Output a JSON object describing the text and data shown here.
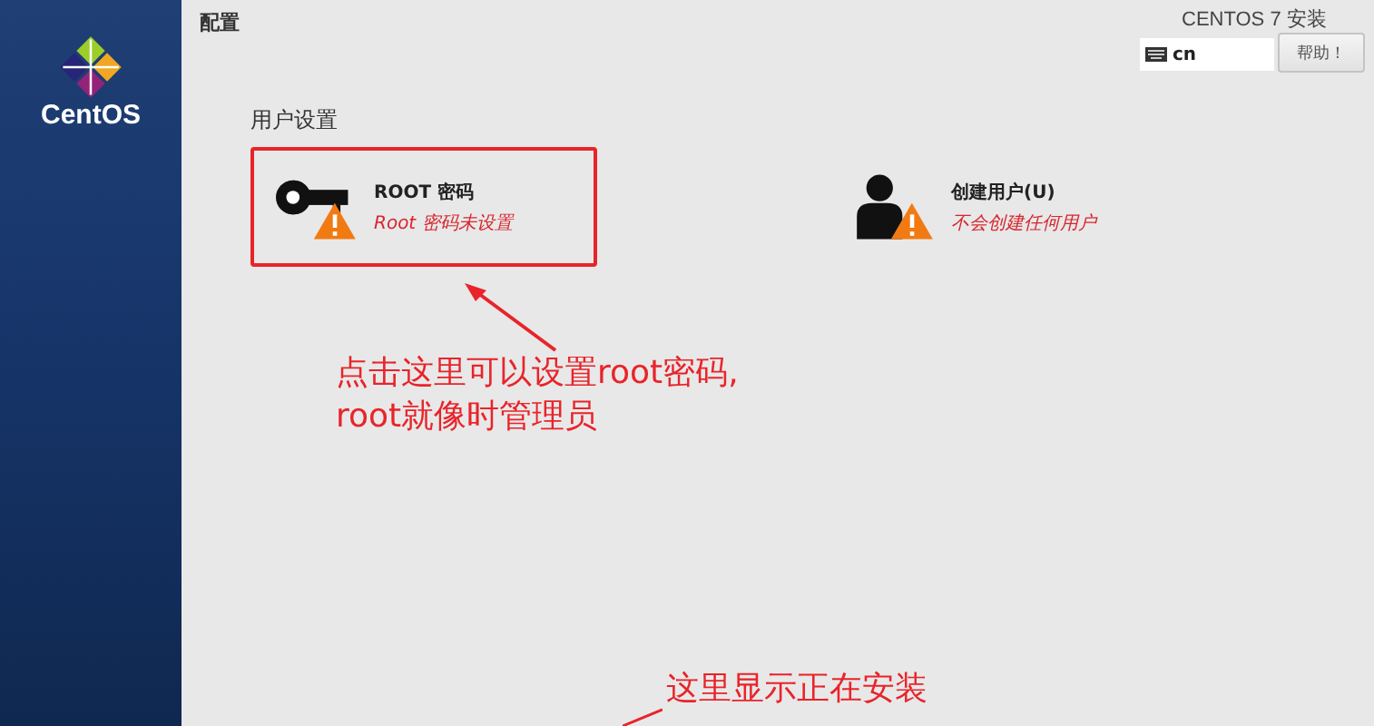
{
  "sidebar": {
    "logo_text": "CentOS"
  },
  "header": {
    "title": "配置",
    "product": "CENTOS 7 安装",
    "keyboard": {
      "value": "cn"
    },
    "help_button": "帮助！"
  },
  "section": {
    "title": "用户设置",
    "spokes": [
      {
        "kind": "root",
        "title": "ROOT 密码",
        "status": "Root 密码未设置",
        "highlighted": true,
        "warning": true
      },
      {
        "kind": "user",
        "title": "创建用户(U)",
        "status": "不会创建任何用户",
        "highlighted": false,
        "warning": true
      }
    ]
  },
  "annotations": [
    {
      "text": "点击这里可以设置root密码,\nroot就像时管理员"
    },
    {
      "text": "这里显示正在安装"
    }
  ]
}
